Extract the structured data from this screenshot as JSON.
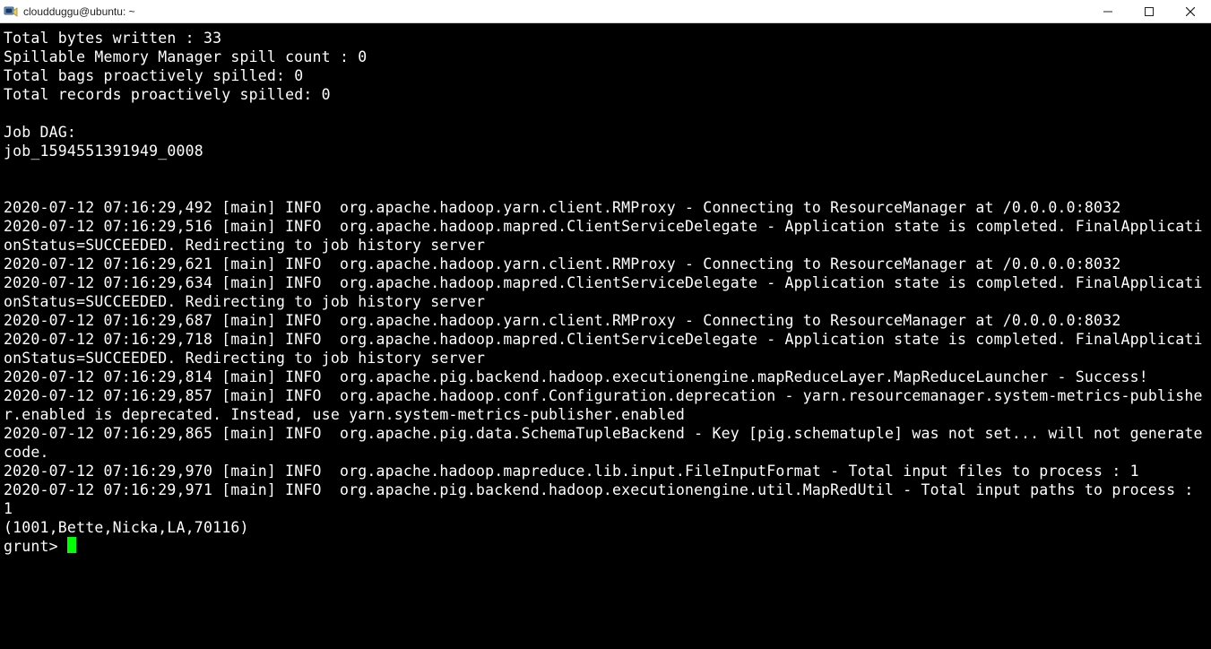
{
  "window": {
    "title": "cloudduggu@ubuntu: ~"
  },
  "terminal": {
    "lines": [
      "Total bytes written : 33",
      "Spillable Memory Manager spill count : 0",
      "Total bags proactively spilled: 0",
      "Total records proactively spilled: 0",
      "",
      "Job DAG:",
      "job_1594551391949_0008",
      "",
      "",
      "2020-07-12 07:16:29,492 [main] INFO  org.apache.hadoop.yarn.client.RMProxy - Connecting to ResourceManager at /0.0.0.0:8032",
      "2020-07-12 07:16:29,516 [main] INFO  org.apache.hadoop.mapred.ClientServiceDelegate - Application state is completed. FinalApplicationStatus=SUCCEEDED. Redirecting to job history server",
      "2020-07-12 07:16:29,621 [main] INFO  org.apache.hadoop.yarn.client.RMProxy - Connecting to ResourceManager at /0.0.0.0:8032",
      "2020-07-12 07:16:29,634 [main] INFO  org.apache.hadoop.mapred.ClientServiceDelegate - Application state is completed. FinalApplicationStatus=SUCCEEDED. Redirecting to job history server",
      "2020-07-12 07:16:29,687 [main] INFO  org.apache.hadoop.yarn.client.RMProxy - Connecting to ResourceManager at /0.0.0.0:8032",
      "2020-07-12 07:16:29,718 [main] INFO  org.apache.hadoop.mapred.ClientServiceDelegate - Application state is completed. FinalApplicationStatus=SUCCEEDED. Redirecting to job history server",
      "2020-07-12 07:16:29,814 [main] INFO  org.apache.pig.backend.hadoop.executionengine.mapReduceLayer.MapReduceLauncher - Success!",
      "2020-07-12 07:16:29,857 [main] INFO  org.apache.hadoop.conf.Configuration.deprecation - yarn.resourcemanager.system-metrics-publisher.enabled is deprecated. Instead, use yarn.system-metrics-publisher.enabled",
      "2020-07-12 07:16:29,865 [main] INFO  org.apache.pig.data.SchemaTupleBackend - Key [pig.schematuple] was not set... will not generate code.",
      "2020-07-12 07:16:29,970 [main] INFO  org.apache.hadoop.mapreduce.lib.input.FileInputFormat - Total input files to process : 1",
      "2020-07-12 07:16:29,971 [main] INFO  org.apache.pig.backend.hadoop.executionengine.util.MapRedUtil - Total input paths to process : 1",
      "(1001,Bette,Nicka,LA,70116)"
    ],
    "prompt": "grunt> "
  }
}
